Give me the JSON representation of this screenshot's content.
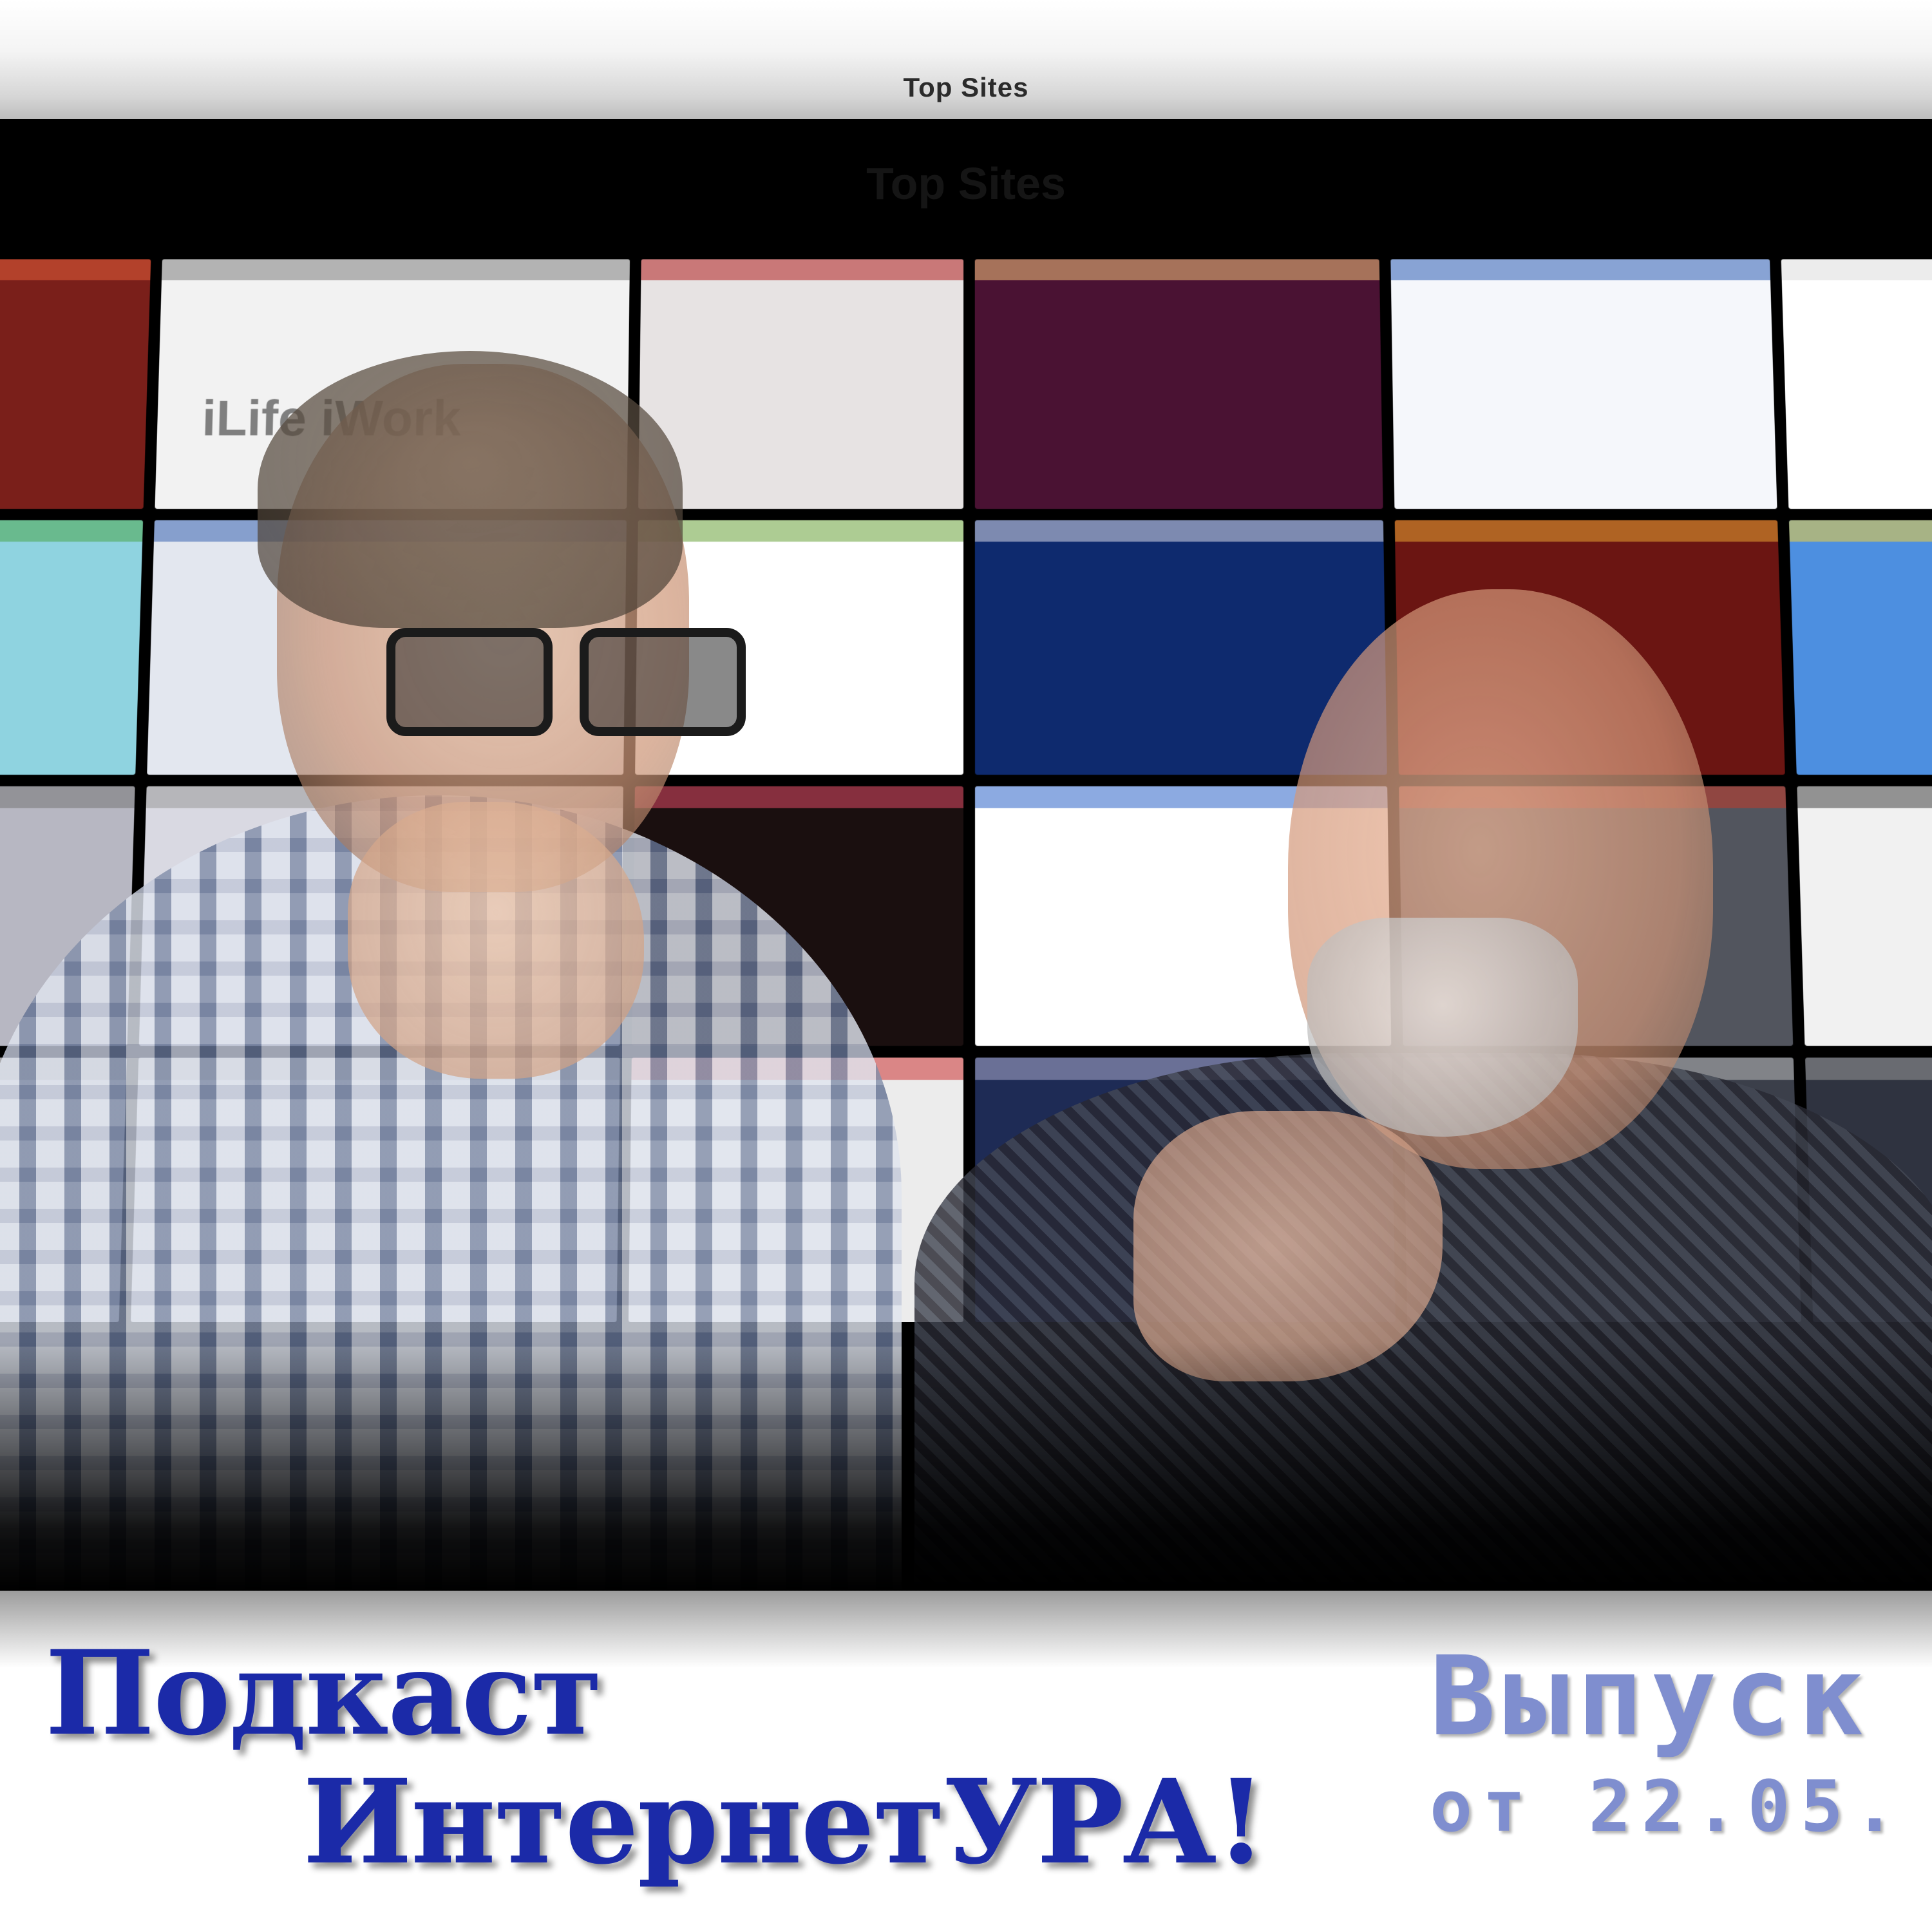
{
  "window": {
    "title": "Top Sites"
  },
  "stage": {
    "faint_heading": "Top Sites"
  },
  "tiles": [
    {
      "name": "tile-thumbnail-1",
      "bg": "#7a1f1a",
      "accent": "#e25d3a",
      "text": ""
    },
    {
      "name": "tile-ilife-iwork",
      "bg": "#f2f2f2",
      "accent": "#7f7f7f",
      "text": "iLife iWork"
    },
    {
      "name": "tile-thumbnail-3",
      "bg": "#e7e3e3",
      "accent": "#b02020",
      "text": ""
    },
    {
      "name": "tile-thumbnail-4",
      "bg": "#4a1233",
      "accent": "#f3c17a",
      "text": ""
    },
    {
      "name": "tile-thumbnail-5",
      "bg": "#f5f7fb",
      "accent": "#2e5fb5",
      "text": ""
    },
    {
      "name": "tile-thumbnail-6",
      "bg": "#ffffff",
      "accent": "#dcdcdc",
      "text": ""
    },
    {
      "name": "tile-thumbnail-7",
      "bg": "#8fd3e0",
      "accent": "#4aa54a",
      "text": ""
    },
    {
      "name": "tile-thumbnail-8",
      "bg": "#e3e7ef",
      "accent": "#3a64b0",
      "text": ""
    },
    {
      "name": "tile-thumbnail-9",
      "bg": "#ffffff",
      "accent": "#6aa33a",
      "text": ""
    },
    {
      "name": "tile-thumbnail-10",
      "bg": "#0e2a6e",
      "accent": "#d8d8e8",
      "text": ""
    },
    {
      "name": "tile-thumbnail-11",
      "bg": "#6b1512",
      "accent": "#e7a432",
      "text": ""
    },
    {
      "name": "tile-thumbnail-12",
      "bg": "#4d8fe0",
      "accent": "#f3d23a",
      "text": ""
    },
    {
      "name": "tile-thumbnail-13",
      "bg": "#b7b7c2",
      "accent": "#777",
      "text": ""
    },
    {
      "name": "tile-thumbnail-14",
      "bg": "#d9d9e2",
      "accent": "#999",
      "text": ""
    },
    {
      "name": "tile-thumbnail-15",
      "bg": "#1a0f0f",
      "accent": "#e04a66",
      "text": ""
    },
    {
      "name": "tile-thumbnail-16",
      "bg": "#ffffff",
      "accent": "#2d65c8",
      "text": ""
    },
    {
      "name": "tile-thumbnail-17",
      "bg": "#52555e",
      "accent": "#c23a2a",
      "text": ""
    },
    {
      "name": "tile-thumbnail-18",
      "bg": "#f1f1f1",
      "accent": "#444",
      "text": ""
    },
    {
      "name": "tile-thumbnail-19",
      "bg": "#cfcfd6",
      "accent": "#888",
      "text": ""
    },
    {
      "name": "tile-thumbnail-20",
      "bg": "#dadde3",
      "accent": "#999",
      "text": ""
    },
    {
      "name": "tile-thumbnail-21",
      "bg": "#ececec",
      "accent": "#c33",
      "text": ""
    },
    {
      "name": "tile-thumbnail-22",
      "bg": "#1e2b55",
      "accent": "#aac",
      "text": ""
    },
    {
      "name": "tile-thumbnail-23",
      "bg": "#3b3f4a",
      "accent": "#bbb",
      "text": ""
    },
    {
      "name": "tile-thumbnail-24",
      "bg": "#2f3340",
      "accent": "#999",
      "text": ""
    }
  ],
  "caption": {
    "line1": "Подкаст",
    "line2": "ИнтернетУРА!",
    "issue": "Выпуск",
    "date": "от 22.05."
  },
  "colors": {
    "title_blue": "#1b2aa8",
    "issue_blue": "#7f8ecf"
  }
}
